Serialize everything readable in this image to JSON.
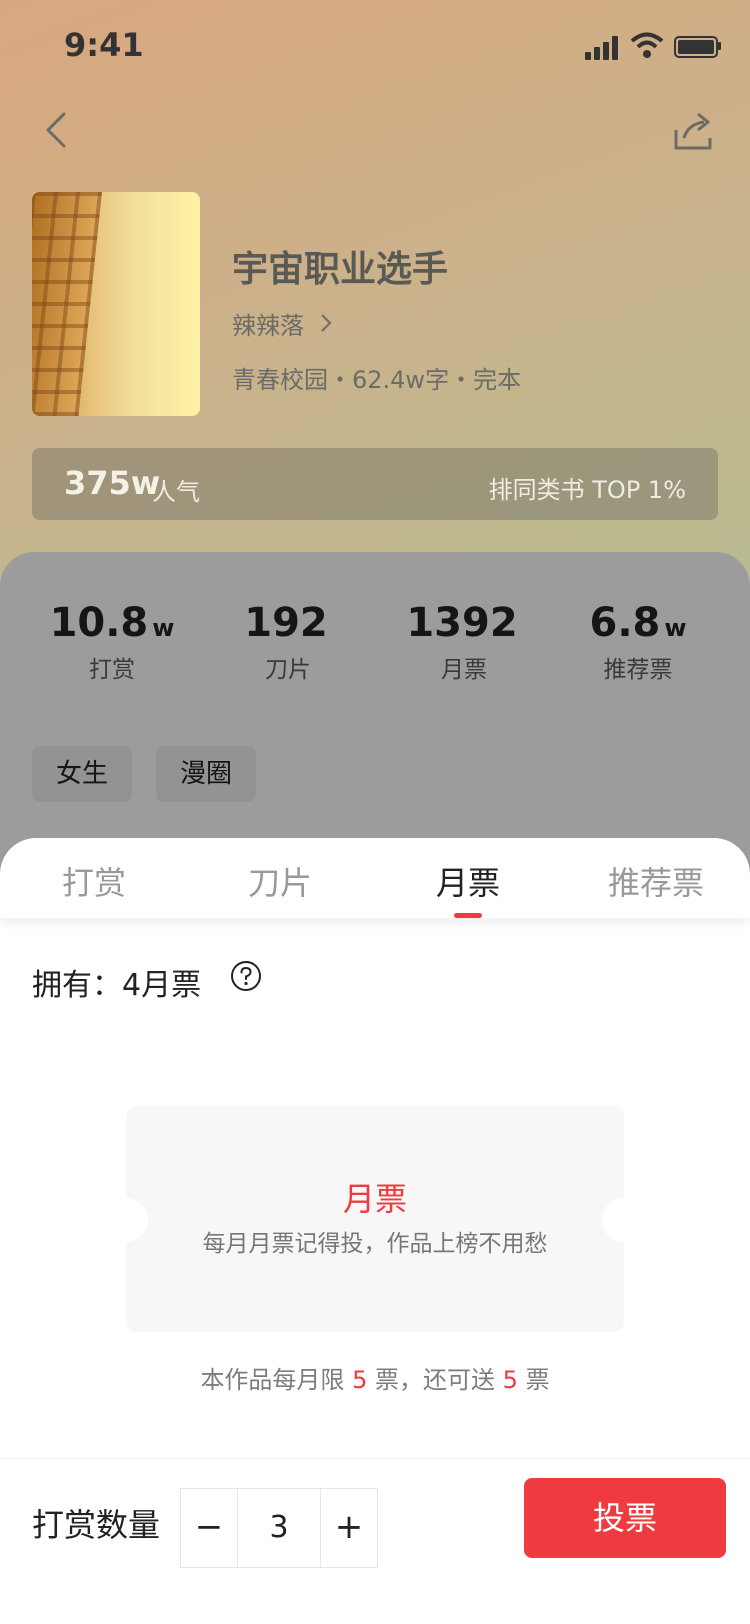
{
  "status_bar": {
    "time": "9:41"
  },
  "book": {
    "title": "宇宙职业选手",
    "author": "辣辣落",
    "meta": "青春校园・62.4w字・完本",
    "popularity_value": "375w",
    "popularity_label": "人气",
    "rank_text": "排同类书 TOP 1%"
  },
  "stats": [
    {
      "value": "10.8",
      "unit": "w",
      "label": "打赏"
    },
    {
      "value": "192",
      "unit": "",
      "label": "刀片"
    },
    {
      "value": "1392",
      "unit": "",
      "label": "月票"
    },
    {
      "value": "6.8",
      "unit": "w",
      "label": "推荐票"
    }
  ],
  "tags": [
    "女生",
    "漫圈"
  ],
  "sheet": {
    "tabs": [
      "打赏",
      "刀片",
      "月票",
      "推荐票"
    ],
    "active_tab": 2,
    "owned_text": "拥有：4月票",
    "ticket_title": "月票",
    "ticket_subtitle": "每月月票记得投，作品上榜不用愁",
    "limit_prefix": "本作品每月限",
    "limit_num": "5",
    "limit_mid": "票，还可送",
    "limit_num2": "5",
    "limit_suffix": "票",
    "quantity_label": "打赏数量",
    "quantity_value": "3",
    "minus_label": "−",
    "plus_label": "+",
    "vote_label": "投票"
  },
  "colors": {
    "accent": "#ef3b3f"
  }
}
